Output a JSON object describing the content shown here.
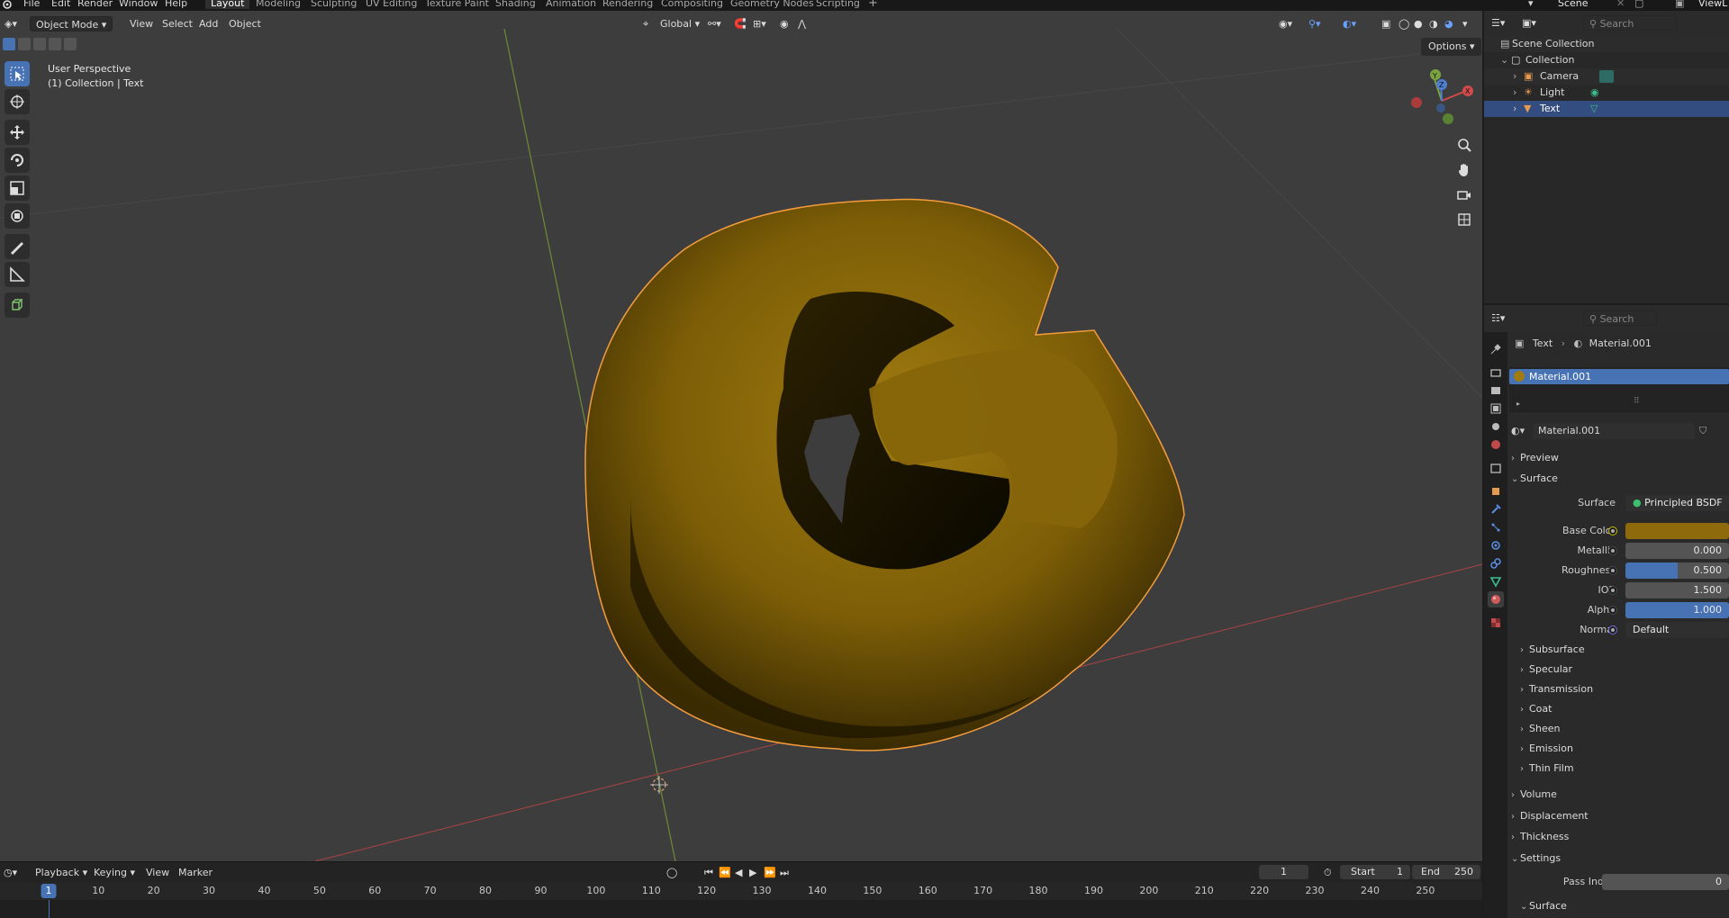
{
  "top_menu": {
    "items": [
      "File",
      "Edit",
      "Render",
      "Window",
      "Help"
    ],
    "workspaces": [
      "Layout",
      "Modeling",
      "Sculpting",
      "UV Editing",
      "Texture Paint",
      "Shading",
      "Animation",
      "Rendering",
      "Compositing",
      "Geometry Nodes",
      "Scripting"
    ],
    "active_workspace": "Layout",
    "add_workspace": "+",
    "scene_name": "Scene",
    "view_layer_name": "ViewL"
  },
  "viewport_header": {
    "mode": "Object Mode",
    "menus": [
      "View",
      "Select",
      "Add",
      "Object"
    ],
    "transform_orientation": "Global",
    "options_label": "Options"
  },
  "viewport": {
    "info_line1": "User Perspective",
    "info_line2": "(1) Collection | Text",
    "gizmo_axes": {
      "x": "X",
      "y": "Y",
      "z": "Z"
    },
    "object_color": "#8a6a08",
    "selection_outline_color": "#f39c3c"
  },
  "timeline": {
    "menus": [
      "Playback",
      "Keying",
      "View",
      "Marker"
    ],
    "current_frame": "1",
    "start_label": "Start",
    "start_value": "1",
    "end_label": "End",
    "end_value": "250",
    "ruler": [
      "10",
      "20",
      "30",
      "40",
      "50",
      "60",
      "70",
      "80",
      "90",
      "100",
      "110",
      "120",
      "130",
      "140",
      "150",
      "160",
      "170",
      "180",
      "190",
      "200",
      "210",
      "220",
      "230",
      "240",
      "250"
    ],
    "ruler_current": "1"
  },
  "outliner": {
    "search_placeholder": "Search",
    "rows": [
      {
        "label": "Scene Collection"
      },
      {
        "label": "Collection"
      },
      {
        "label": "Camera"
      },
      {
        "label": "Light"
      },
      {
        "label": "Text"
      }
    ]
  },
  "properties": {
    "search_placeholder": "Search",
    "breadcrumb_object": "Text",
    "breadcrumb_material": "Material.001",
    "slot_name": "Material.001",
    "material_name": "Material.001",
    "sections": {
      "preview": "Preview",
      "surface": "Surface",
      "volume": "Volume",
      "displacement": "Displacement",
      "thickness": "Thickness",
      "settings": "Settings",
      "settings_surface": "Surface"
    },
    "surface_label": "Surface",
    "surface_value": "Principled BSDF",
    "fields": {
      "base_color_label": "Base Color",
      "base_color": "#8e6a0c",
      "metallic_label": "Metallic",
      "metallic": "0.000",
      "roughness_label": "Roughness",
      "roughness": "0.500",
      "roughness_fraction": 0.5,
      "ior_label": "IOR",
      "ior": "1.500",
      "alpha_label": "Alpha",
      "alpha": "1.000",
      "alpha_fraction": 1.0,
      "normal_label": "Normal",
      "normal": "Default",
      "pass_index_label": "Pass Index",
      "pass_index": "0"
    },
    "subsections": [
      "Subsurface",
      "Specular",
      "Transmission",
      "Coat",
      "Sheen",
      "Emission",
      "Thin Film"
    ]
  },
  "icons": {
    "logo": "blender-logo-icon",
    "select": "select-box-icon",
    "cursor": "cursor-icon",
    "move": "move-icon",
    "rotate": "rotate-icon",
    "scale": "scale-icon",
    "transform": "transform-icon",
    "annotate": "annotate-icon",
    "measure": "measure-icon",
    "add_cube": "add-cube-icon"
  }
}
